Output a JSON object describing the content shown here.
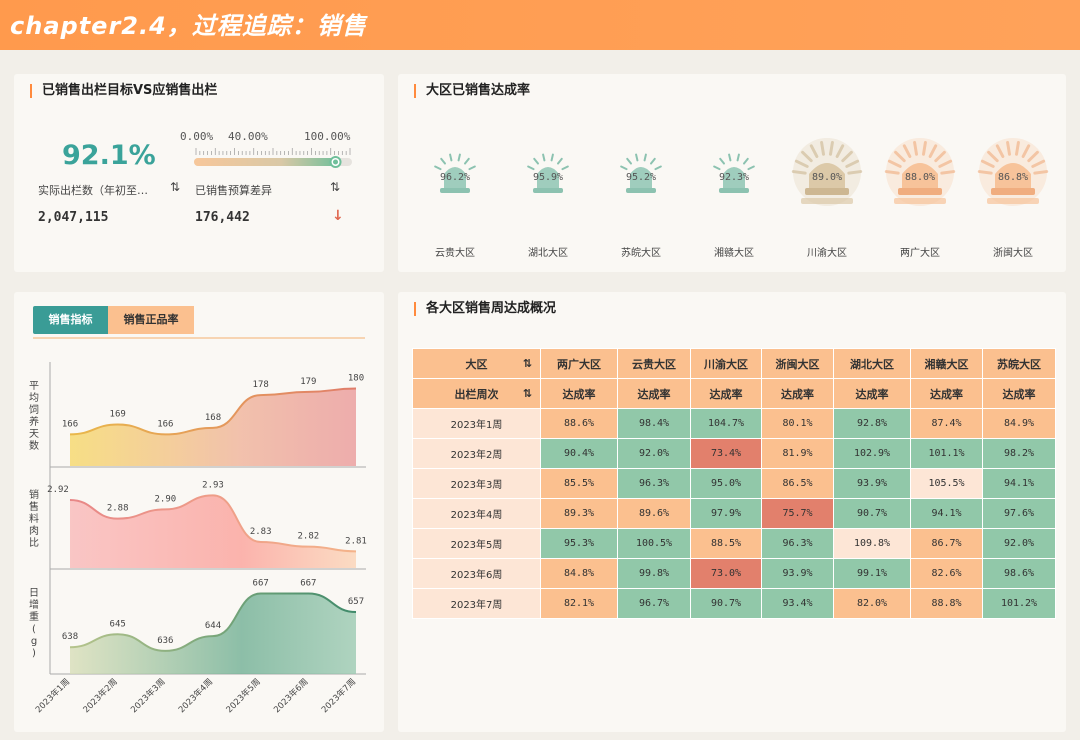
{
  "header": {
    "title": "chapter2.4，过程追踪：销售"
  },
  "kpi_card": {
    "title": "已销售出栏目标VS应销售出栏",
    "percent": "92.1%",
    "scale_labels": [
      "0.00%",
      "40.00%",
      "100.00%"
    ],
    "progress": 0.921,
    "left_label": "实际出栏数（年初至…",
    "left_value": "2,047,115",
    "right_label": "已销售预算差异",
    "right_value": "176,442",
    "sort_icon": "sort-icon",
    "trend_icon": "arrow-down-icon",
    "colors": {
      "accent": "#3aa39a",
      "down": "#e0674f"
    }
  },
  "region_card": {
    "title": "大区已销售达成率",
    "regions": [
      {
        "name": "云贵大区",
        "rate": "96.2%",
        "status": "green"
      },
      {
        "name": "湖北大区",
        "rate": "95.9%",
        "status": "green"
      },
      {
        "name": "苏皖大区",
        "rate": "95.2%",
        "status": "green"
      },
      {
        "name": "湘赣大区",
        "rate": "92.3%",
        "status": "green"
      },
      {
        "name": "川渝大区",
        "rate": "89.0%",
        "status": "tan"
      },
      {
        "name": "两广大区",
        "rate": "88.0%",
        "status": "orange"
      },
      {
        "name": "浙闽大区",
        "rate": "86.8%",
        "status": "orange"
      }
    ]
  },
  "left_panel": {
    "tabs": [
      {
        "label": "销售指标",
        "active": true
      },
      {
        "label": "销售正品率",
        "active": false
      }
    ]
  },
  "chart_data": [
    {
      "type": "area",
      "ylabel": "平均饲养天数",
      "categories": [
        "2023年1周",
        "2023年2周",
        "2023年3周",
        "2023年4周",
        "2023年5周",
        "2023年6周",
        "2023年7周"
      ],
      "series": [
        {
          "values": [
            166,
            169,
            166,
            168,
            178,
            179,
            180
          ]
        }
      ],
      "labels": [
        "166",
        "169",
        "166",
        "168",
        "178",
        "179",
        "180"
      ],
      "ylim": [
        160,
        182
      ]
    },
    {
      "type": "area",
      "ylabel": "销售料肉比",
      "categories": [
        "2023年1周",
        "2023年2周",
        "2023年3周",
        "2023年4周",
        "2023年5周",
        "2023年6周",
        "2023年7周"
      ],
      "series": [
        {
          "values": [
            2.92,
            2.88,
            2.9,
            2.93,
            2.83,
            2.82,
            2.81
          ]
        }
      ],
      "labels": [
        "2.92",
        "2.88",
        "2.90",
        "2.93",
        "2.83",
        "2.82",
        "2.81"
      ],
      "ylim": [
        2.8,
        2.95
      ]
    },
    {
      "type": "area",
      "ylabel": "日增重(g)",
      "categories": [
        "2023年1周",
        "2023年2周",
        "2023年3周",
        "2023年4周",
        "2023年5周",
        "2023年6周",
        "2023年7周"
      ],
      "series": [
        {
          "values": [
            638,
            645,
            636,
            644,
            667,
            667,
            657
          ]
        }
      ],
      "labels": [
        "638",
        "645",
        "636",
        "644",
        "667",
        "667",
        "657"
      ],
      "ylim": [
        630,
        670
      ]
    }
  ],
  "table_card": {
    "title": "各大区销售周达成概况",
    "header_row1_first": "大区",
    "header_row2_first": "出栏周次",
    "regions": [
      "两广大区",
      "云贵大区",
      "川渝大区",
      "浙闽大区",
      "湖北大区",
      "湘赣大区",
      "苏皖大区"
    ],
    "metric_label": "达成率",
    "rows": [
      {
        "week": "2023年1周",
        "values": [
          "88.6%",
          "98.4%",
          "104.7%",
          "80.1%",
          "92.8%",
          "87.4%",
          "84.9%"
        ],
        "colors": [
          "o",
          "g",
          "g",
          "o",
          "g",
          "o",
          "o"
        ]
      },
      {
        "week": "2023年2周",
        "values": [
          "90.4%",
          "92.0%",
          "73.4%",
          "81.9%",
          "102.9%",
          "101.1%",
          "98.2%"
        ],
        "colors": [
          "g",
          "g",
          "r",
          "o",
          "g",
          "g",
          "g"
        ]
      },
      {
        "week": "2023年3周",
        "values": [
          "85.5%",
          "96.3%",
          "95.0%",
          "86.5%",
          "93.9%",
          "105.5%",
          "94.1%"
        ],
        "colors": [
          "o",
          "g",
          "g",
          "o",
          "g",
          "l",
          "g"
        ]
      },
      {
        "week": "2023年4周",
        "values": [
          "89.3%",
          "89.6%",
          "97.9%",
          "75.7%",
          "90.7%",
          "94.1%",
          "97.6%"
        ],
        "colors": [
          "o",
          "o",
          "g",
          "r",
          "g",
          "g",
          "g"
        ]
      },
      {
        "week": "2023年5周",
        "values": [
          "95.3%",
          "100.5%",
          "88.5%",
          "96.3%",
          "109.8%",
          "86.7%",
          "92.0%"
        ],
        "colors": [
          "g",
          "g",
          "o",
          "g",
          "l",
          "o",
          "g"
        ]
      },
      {
        "week": "2023年6周",
        "values": [
          "84.8%",
          "99.8%",
          "73.0%",
          "93.9%",
          "99.1%",
          "82.6%",
          "98.6%"
        ],
        "colors": [
          "o",
          "g",
          "r",
          "g",
          "g",
          "o",
          "g"
        ]
      },
      {
        "week": "2023年7周",
        "values": [
          "82.1%",
          "96.7%",
          "90.7%",
          "93.4%",
          "82.0%",
          "88.8%",
          "101.2%"
        ],
        "colors": [
          "o",
          "g",
          "g",
          "g",
          "o",
          "o",
          "g"
        ]
      }
    ]
  }
}
